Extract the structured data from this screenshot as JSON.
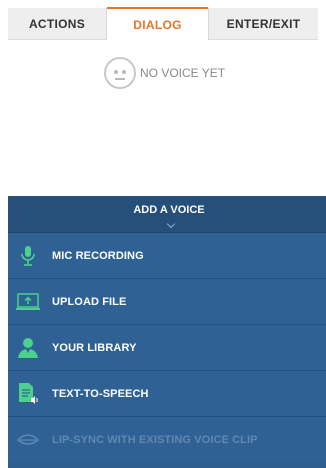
{
  "tabs": [
    {
      "label": "ACTIONS",
      "active": false
    },
    {
      "label": "DIALOG",
      "active": true
    },
    {
      "label": "ENTER/EXIT",
      "active": false
    }
  ],
  "status": {
    "label": "NO VOICE YET",
    "icon": "neutral-face-icon"
  },
  "voice_panel": {
    "title": "ADD A VOICE",
    "items": [
      {
        "label": "MIC RECORDING",
        "icon": "microphone-icon"
      },
      {
        "label": "UPLOAD FILE",
        "icon": "upload-icon"
      },
      {
        "label": "YOUR LIBRARY",
        "icon": "user-library-icon"
      },
      {
        "label": "TEXT-TO-SPEECH",
        "icon": "text-to-speech-icon"
      },
      {
        "label": "LIP-SYNC WITH EXISTING VOICE CLIP",
        "icon": "lip-sync-icon",
        "disabled": true
      }
    ]
  },
  "colors": {
    "accent": "#e8742a",
    "panel": "#2d5d8c",
    "icon_green": "#4bd08e"
  }
}
